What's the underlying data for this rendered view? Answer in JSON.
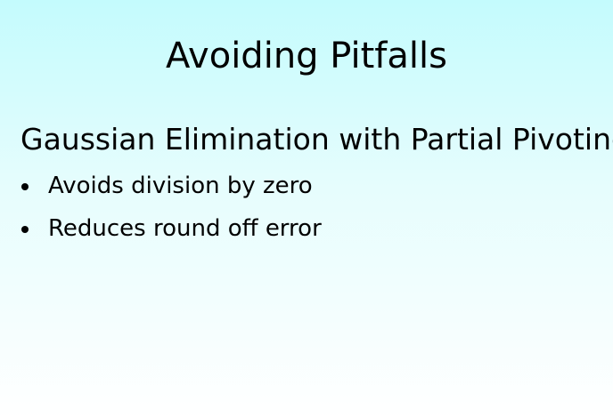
{
  "slide": {
    "title": "Avoiding Pitfalls",
    "heading": "Gaussian Elimination with Partial Pivoting",
    "bullets": [
      "Avoids division by zero",
      "Reduces round off error"
    ]
  }
}
